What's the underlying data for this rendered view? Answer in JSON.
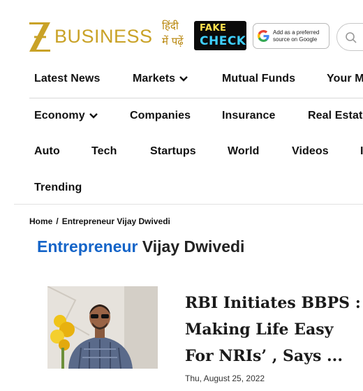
{
  "brand": {
    "logo_letter": "Z",
    "logo_text": "BUSINESS",
    "hindi_line1": "हिंदी",
    "hindi_line2": "में पढ़ें"
  },
  "fake_check": {
    "line1": "FAKE",
    "line2": "CHECK"
  },
  "google": {
    "line1": "Add as a preferred",
    "line2": "source on Google"
  },
  "nav": {
    "row1": [
      "Latest News",
      "Markets",
      "Mutual Funds",
      "Your M"
    ],
    "row2": [
      "Economy",
      "Companies",
      "Insurance",
      "Real Estate"
    ],
    "row3": [
      "Auto",
      "Tech",
      "Startups",
      "World",
      "Videos",
      "I"
    ],
    "row4": [
      "Trending"
    ]
  },
  "breadcrumb": {
    "home": "Home",
    "separator": "/",
    "current": "Entrepreneur Vijay Dwivedi"
  },
  "page": {
    "title_highlight": "Entrepreneur",
    "title_rest": " Vijay Dwivedi"
  },
  "article": {
    "title_line1": "RBI Initiates BBPS :",
    "title_line2": "Making Life Easy",
    "title_line3": "For NRIs’ , Says ...",
    "date": "Thu, August 25, 2022"
  },
  "colors": {
    "brand_gold": "#c9a227",
    "accent_blue": "#1464c8"
  },
  "icons": [
    "z-logo-icon",
    "google-g-icon",
    "search-icon",
    "chevron-down-icon"
  ]
}
